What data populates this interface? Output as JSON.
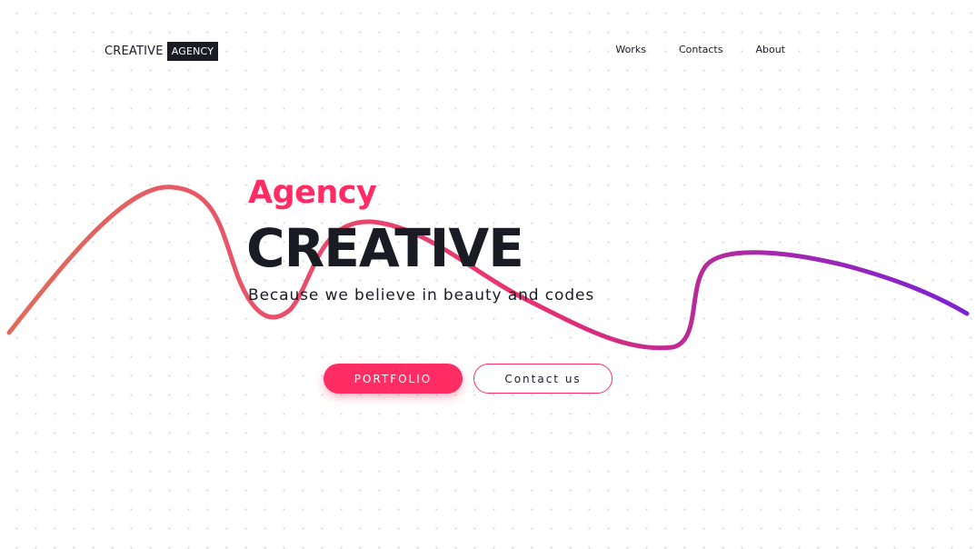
{
  "header": {
    "logo": {
      "main": "CREATIVE",
      "badge": "AGENCY"
    },
    "nav": [
      {
        "label": "Works"
      },
      {
        "label": "Contacts"
      },
      {
        "label": "About"
      }
    ]
  },
  "hero": {
    "subtitle": "Agency",
    "title": "CREATIVE",
    "tagline": "Because we believe in beauty and codes"
  },
  "buttons": {
    "primary": "PORTFOLIO",
    "secondary": "Contact us"
  },
  "colors": {
    "accent": "#ff2d64",
    "text": "#1b1b24",
    "wave_start": "#df6b5a",
    "wave_mid": "#e92f6f",
    "wave_end": "#7b22d6"
  }
}
